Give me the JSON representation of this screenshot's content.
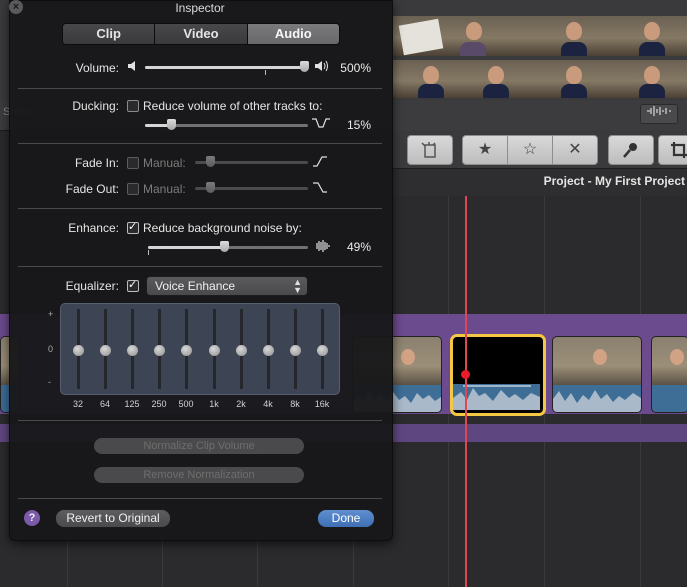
{
  "inspector": {
    "title": "Inspector",
    "close_icon": "close-icon",
    "tabs": [
      {
        "label": "Clip",
        "active": false
      },
      {
        "label": "Video",
        "active": false
      },
      {
        "label": "Audio",
        "active": true
      }
    ],
    "volume": {
      "label": "Volume:",
      "value": "500%",
      "level": 1.0
    },
    "ducking": {
      "label": "Ducking:",
      "checkbox_label": "Reduce volume of other tracks to:",
      "checked": false,
      "value": "15%",
      "level": 0.15
    },
    "fade_in": {
      "label": "Fade In:",
      "mode": "Manual:",
      "checked": false
    },
    "fade_out": {
      "label": "Fade Out:",
      "mode": "Manual:",
      "checked": false
    },
    "enhance": {
      "label": "Enhance:",
      "checkbox_label": "Reduce background noise by:",
      "checked": true,
      "value": "49%",
      "level": 0.49
    },
    "equalizer": {
      "label": "Equalizer:",
      "checked": true,
      "preset": "Voice Enhance",
      "scale": {
        "plus": "+",
        "zero": "0",
        "minus": "-"
      },
      "bands": [
        "32",
        "64",
        "125",
        "250",
        "500",
        "1k",
        "2k",
        "4k",
        "8k",
        "16k"
      ]
    },
    "normalize_button": "Normalize Clip Volume",
    "remove_normalization_button": "Remove Normalization",
    "help_label": "?",
    "revert_button": "Revert to Original",
    "done_button": "Done"
  },
  "background": {
    "show_label": "Show:",
    "project_title": "Project - My First Project"
  },
  "colors": {
    "accent_blue": "#3e6fb5",
    "help_purple": "#7b5aa9",
    "playhead": "#e24652",
    "selection": "#f4c843",
    "timeline_band": "#6b4a8e"
  }
}
